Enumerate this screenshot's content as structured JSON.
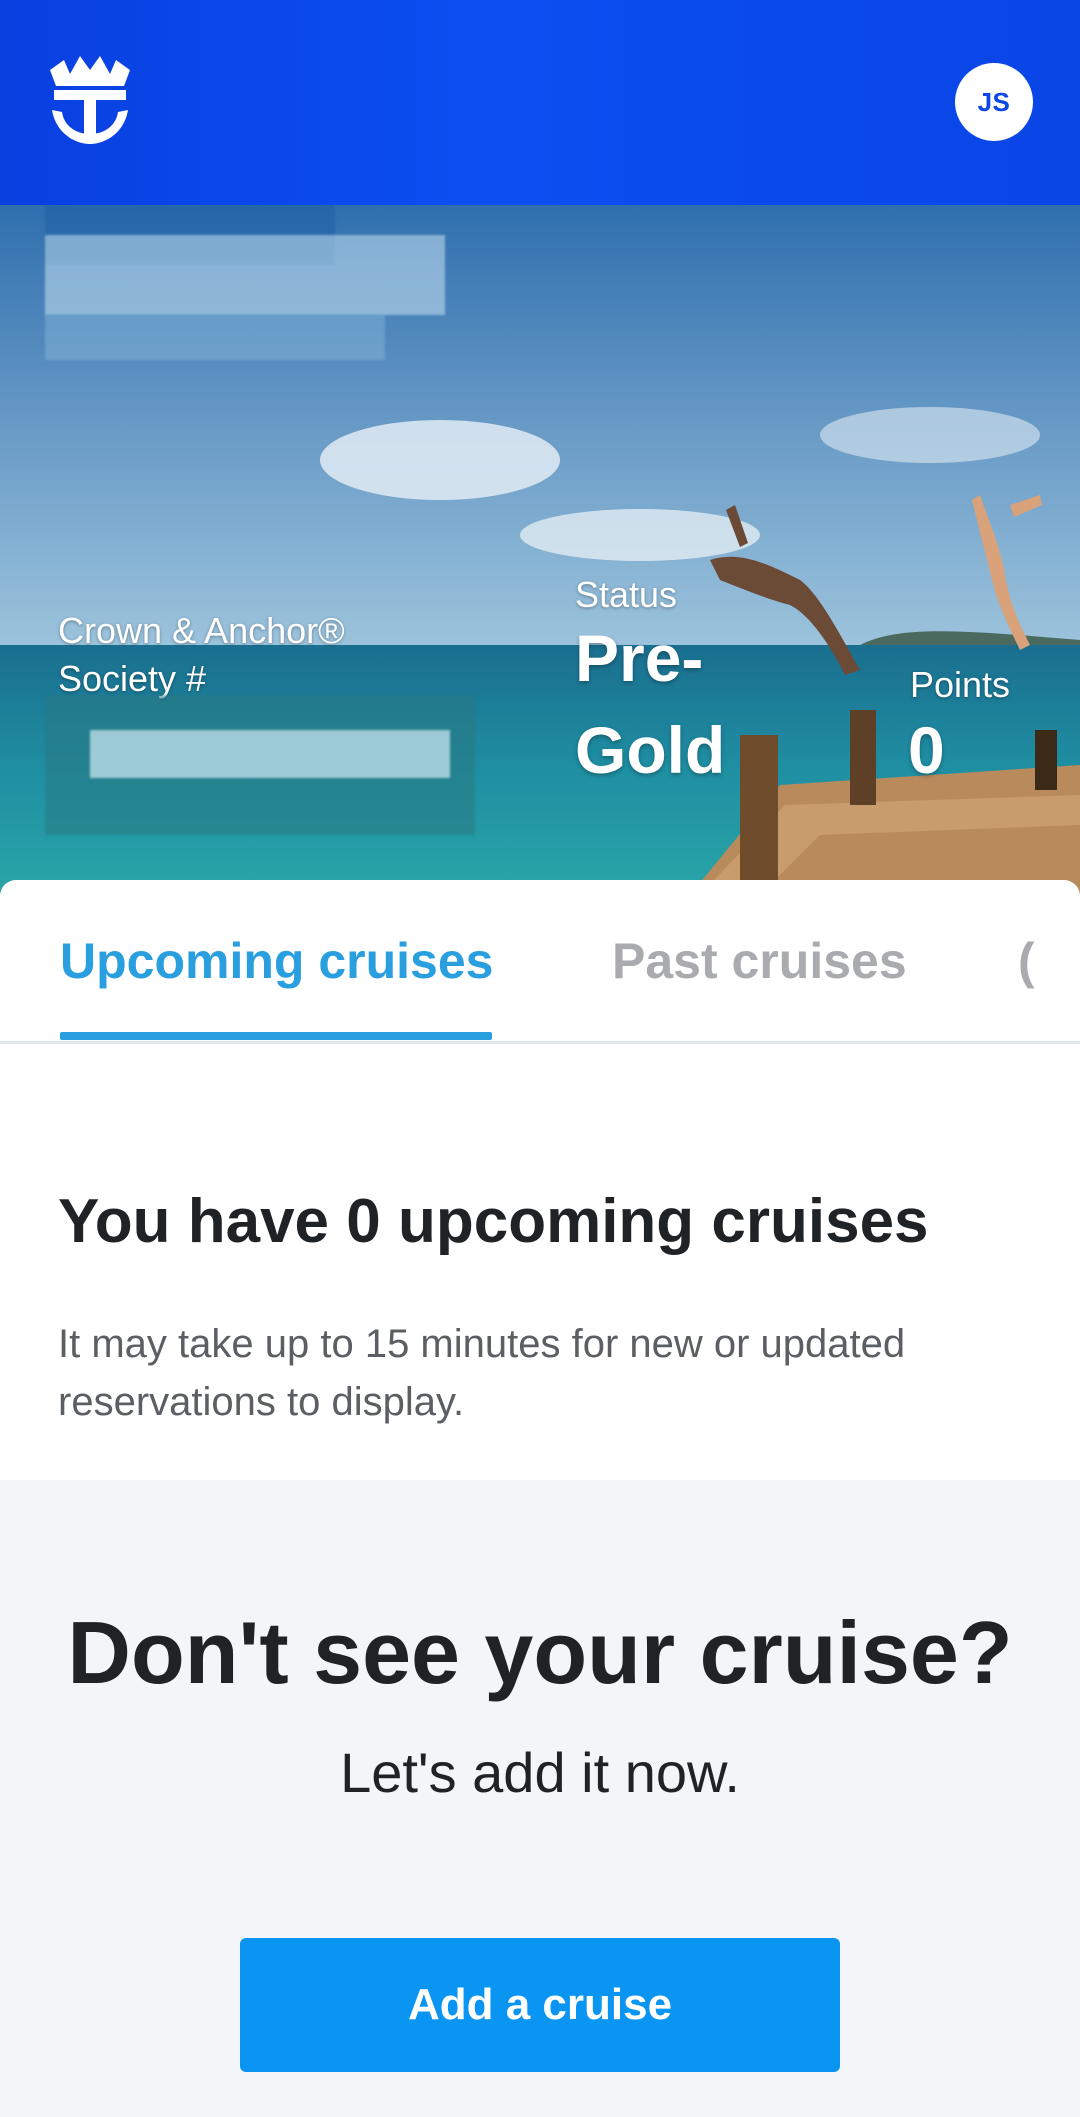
{
  "header": {
    "logo_icon": "crown-anchor-logo-icon",
    "avatar_initials": "JS"
  },
  "hero": {
    "program_label": "Crown & Anchor®",
    "society_label": "Society #",
    "status_label": "Status",
    "status_value_line1": "Pre-",
    "status_value_line2": "Gold",
    "points_label": "Points",
    "points_value": "0"
  },
  "tabs": {
    "upcoming": "Upcoming cruises",
    "past": "Past cruises",
    "more": "("
  },
  "upcoming": {
    "title": "You have 0 upcoming cruises",
    "description": "It may take up to 15 minutes for new or updated reservations to display."
  },
  "add_cruise": {
    "title": "Don't see your cruise?",
    "subtitle": "Let's add it now.",
    "button_label": "Add a cruise"
  },
  "colors": {
    "header_blue": "#0a45e6",
    "accent_blue": "#2a9fe0",
    "button_blue": "#0a95f2"
  }
}
